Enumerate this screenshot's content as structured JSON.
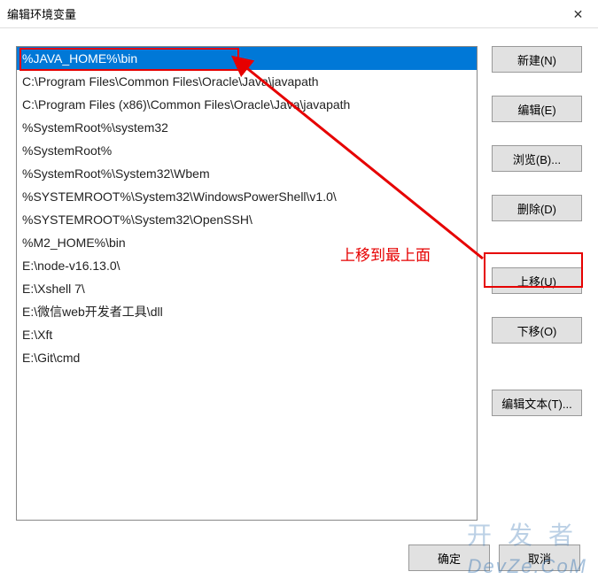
{
  "window": {
    "title": "编辑环境变量",
    "close_label": "✕"
  },
  "list": {
    "items": [
      "%JAVA_HOME%\\bin",
      "C:\\Program Files\\Common Files\\Oracle\\Java\\javapath",
      "C:\\Program Files (x86)\\Common Files\\Oracle\\Java\\javapath",
      "%SystemRoot%\\system32",
      "%SystemRoot%",
      "%SystemRoot%\\System32\\Wbem",
      "%SYSTEMROOT%\\System32\\WindowsPowerShell\\v1.0\\",
      "%SYSTEMROOT%\\System32\\OpenSSH\\",
      "%M2_HOME%\\bin",
      "E:\\node-v16.13.0\\",
      "E:\\Xshell 7\\",
      "E:\\微信web开发者工具\\dll",
      "E:\\Xft",
      "E:\\Git\\cmd"
    ],
    "selected_index": 0
  },
  "buttons": {
    "new": "新建(N)",
    "edit": "编辑(E)",
    "browse": "浏览(B)...",
    "delete": "删除(D)",
    "move_up": "上移(U)",
    "move_down": "下移(O)",
    "edit_text": "编辑文本(T)..."
  },
  "footer": {
    "ok": "确定",
    "cancel": "取消"
  },
  "annotation": {
    "text": "上移到最上面",
    "color": "#e60000"
  },
  "watermark": {
    "line1": "开发者",
    "line2": "DevZe.CoM"
  }
}
